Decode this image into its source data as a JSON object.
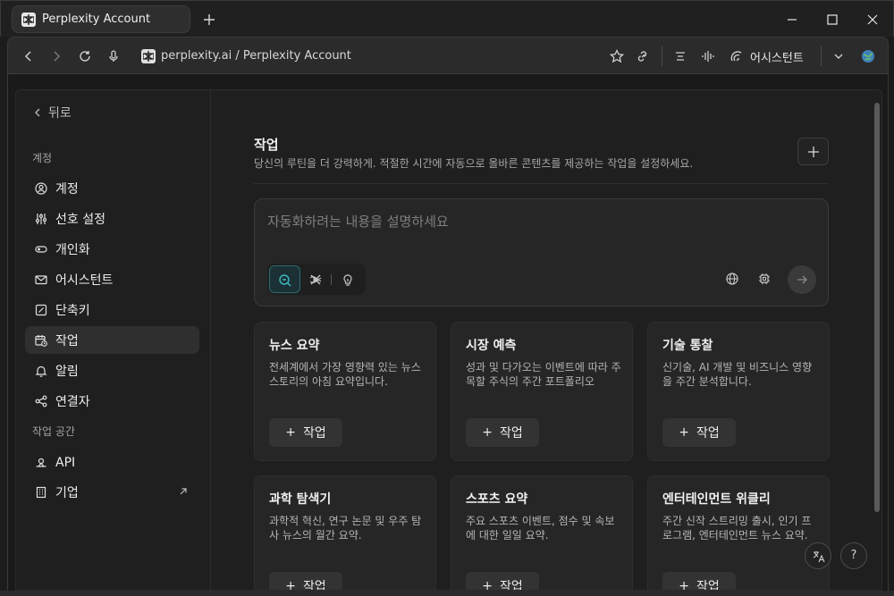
{
  "browser": {
    "tab_title": "Perplexity Account",
    "url": "perplexity.ai / Perplexity Account",
    "assistant_label": "어시스턴트"
  },
  "sidebar": {
    "back_label": "뒤로",
    "section_account": "계정",
    "section_workspace": "작업 공간",
    "items": [
      {
        "label": "계정",
        "icon": "user-circle-icon"
      },
      {
        "label": "선호 설정",
        "icon": "sliders-icon"
      },
      {
        "label": "개인화",
        "icon": "toggle-icon"
      },
      {
        "label": "어시스턴트",
        "icon": "mail-icon"
      },
      {
        "label": "단축키",
        "icon": "shortcut-icon"
      },
      {
        "label": "작업",
        "icon": "calendar-clock-icon",
        "active": true
      },
      {
        "label": "알림",
        "icon": "bell-icon"
      },
      {
        "label": "연결자",
        "icon": "share-nodes-icon"
      },
      {
        "label": "API",
        "icon": "api-icon"
      },
      {
        "label": "기업",
        "icon": "building-icon"
      }
    ]
  },
  "main": {
    "title": "작업",
    "subtitle": "당신의 루틴을 더 강력하게. 적절한 시간에 자동으로 올바른 콘텐츠를 제공하는 작업을 설정하세요.",
    "composer_placeholder": "자동화하려는 내용을 설명하세요",
    "cards": [
      {
        "title": "뉴스 요약",
        "desc": "전세계에서 가장 영향력 있는 뉴스 스토리의 아침 요약입니다.",
        "button": "작업"
      },
      {
        "title": "시장 예측",
        "desc": "성과 및 다가오는 이벤트에 따라 주목할 주식의 주간 포트폴리오",
        "button": "작업"
      },
      {
        "title": "기술 통찰",
        "desc": "신기술, AI 개발 및 비즈니스 영향을 주간 분석합니다.",
        "button": "작업"
      },
      {
        "title": "과학 탐색기",
        "desc": "과학적 혁신, 연구 논문 및 우주 탐사 뉴스의 월간 요약.",
        "button": "작업"
      },
      {
        "title": "스포츠 요약",
        "desc": "주요 스포츠 이벤트, 점수 및 속보에 대한 일일 요약.",
        "button": "작업"
      },
      {
        "title": "엔터테인먼트 위클리",
        "desc": "주간 신작 스트리밍 출시, 인기 프로그램, 엔터테인먼트 뉴스 요약.",
        "button": "작업"
      }
    ]
  },
  "floating": {
    "help_label": "?"
  },
  "colors": {
    "accent_teal": "#2b6a70",
    "background": "#1f1f1f",
    "card": "#262626"
  }
}
